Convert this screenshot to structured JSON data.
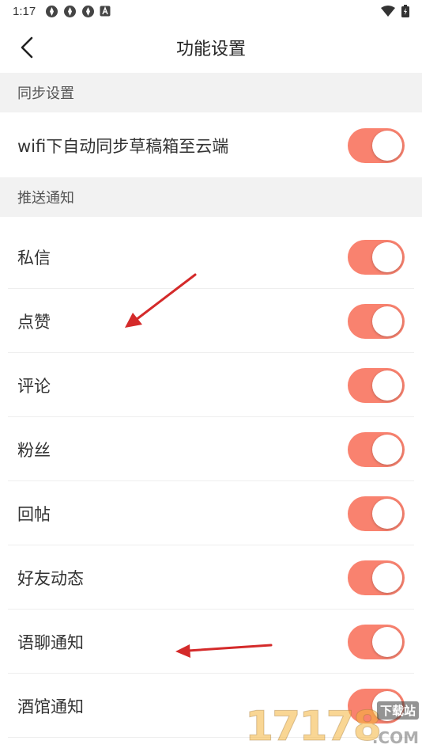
{
  "status_bar": {
    "time": "1:17",
    "icons": [
      "app-icon",
      "app-icon",
      "app-icon",
      "a-icon"
    ],
    "right_icons": [
      "wifi-icon",
      "battery-icon"
    ]
  },
  "header": {
    "title": "功能设置",
    "back_icon": "chevron-left-icon"
  },
  "sections": [
    {
      "title": "同步设置",
      "items": [
        {
          "label": "wifi下自动同步草稿箱至云端",
          "on": true
        }
      ]
    },
    {
      "title": "推送通知",
      "items": [
        {
          "label": "私信",
          "on": true
        },
        {
          "label": "点赞",
          "on": true
        },
        {
          "label": "评论",
          "on": true
        },
        {
          "label": "粉丝",
          "on": true
        },
        {
          "label": "回帖",
          "on": true
        },
        {
          "label": "好友动态",
          "on": true
        },
        {
          "label": "语聊通知",
          "on": true
        },
        {
          "label": "酒馆通知",
          "on": true
        }
      ]
    }
  ],
  "colors": {
    "toggle_on": "#f9826f",
    "section_bg": "#f2f2f2",
    "annotation_arrow": "#d42a2a"
  },
  "watermark": {
    "main": "17178",
    "badge": "下载站",
    "suffix": ".COM"
  }
}
